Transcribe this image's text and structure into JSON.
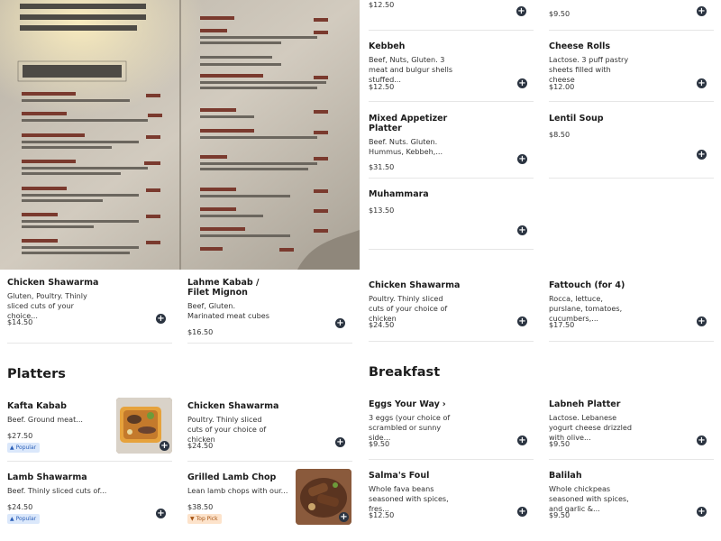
{
  "photo_alt": "",
  "top_partial": {
    "mid_price": "$12.50",
    "right_price": "$9.50"
  },
  "items": {
    "kebbeh": {
      "title": "Kebbeh",
      "desc": "Beef, Nuts, Gluten. 3 meat and bulgur shells stuffed...",
      "price": "$12.50"
    },
    "cheese_rolls": {
      "title": "Cheese Rolls",
      "desc": "Lactose. 3 puff pastry sheets filled with cheese",
      "price": "$12.00"
    },
    "mixed_appetizer": {
      "title": "Mixed Appetizer Platter",
      "desc": "Beef. Nuts. Gluten. Hummus, Kebbeh,...",
      "price": "$31.50"
    },
    "lentil_soup": {
      "title": "Lentil Soup",
      "desc": "",
      "price": "$8.50"
    },
    "muhammara": {
      "title": "Muhammara",
      "desc": "",
      "price": "$13.50"
    },
    "chicken_shawarma_1": {
      "title": "Chicken Shawarma",
      "desc": "Gluten, Poultry. Thinly sliced cuts of your choice...",
      "price": "$14.50"
    },
    "lahme_kabab": {
      "title": "Lahme Kabab / Filet Mignon",
      "desc": "Beef, Gluten. Marinated meat cubes",
      "price": "$16.50"
    },
    "chicken_shawarma_2": {
      "title": "Chicken Shawarma",
      "desc": "Poultry. Thinly sliced cuts of your choice of chicken",
      "price": "$24.50"
    },
    "fattouch": {
      "title": "Fattouch (for 4)",
      "desc": "Rocca, lettuce, purslane, tomatoes, cucumbers,...",
      "price": "$17.50"
    },
    "kafta_kabab": {
      "title": "Kafta Kabab",
      "desc": "Beef. Ground meat...",
      "price": "$27.50",
      "badge": "Popular"
    },
    "chicken_shawarma_3": {
      "title": "Chicken Shawarma",
      "desc": "Poultry. Thinly sliced cuts of your choice of chicken",
      "price": "$24.50"
    },
    "lamb_shawarma": {
      "title": "Lamb Shawarma",
      "desc": "Beef. Thinly sliced cuts of...",
      "price": "$24.50",
      "badge": "Popular"
    },
    "grilled_lamb_chop": {
      "title": "Grilled Lamb Chop",
      "desc": "Lean lamb chops with our...",
      "price": "$38.50",
      "badge": "Top Pick"
    },
    "eggs_your_way": {
      "title": "Eggs Your Way",
      "desc": "3 eggs (your choice of scrambled or sunny side...",
      "price": "$9.50"
    },
    "labneh_platter": {
      "title": "Labneh Platter",
      "desc": "Lactose. Lebanese yogurt cheese drizzled with olive...",
      "price": "$9.50"
    },
    "salmas_foul": {
      "title": "Salma's Foul",
      "desc": "Whole fava beans seasoned with spices, fres...",
      "price": "$12.50"
    },
    "balilah": {
      "title": "Balilah",
      "desc": "Whole chickpeas seasoned with spices, and garlic &...",
      "price": "$9.50"
    }
  },
  "sections": {
    "platters": "Platters",
    "breakfast": "Breakfast"
  },
  "add_label": "+",
  "colors": {
    "accent": "#2b3441",
    "popular_bg": "#dbe8fb",
    "toppick_bg": "#fde3cb"
  },
  "icons": {
    "add": "plus-icon",
    "popular": "thumbs-up-icon",
    "top_pick": "trophy-icon",
    "chevron": "chevron-right-icon"
  }
}
